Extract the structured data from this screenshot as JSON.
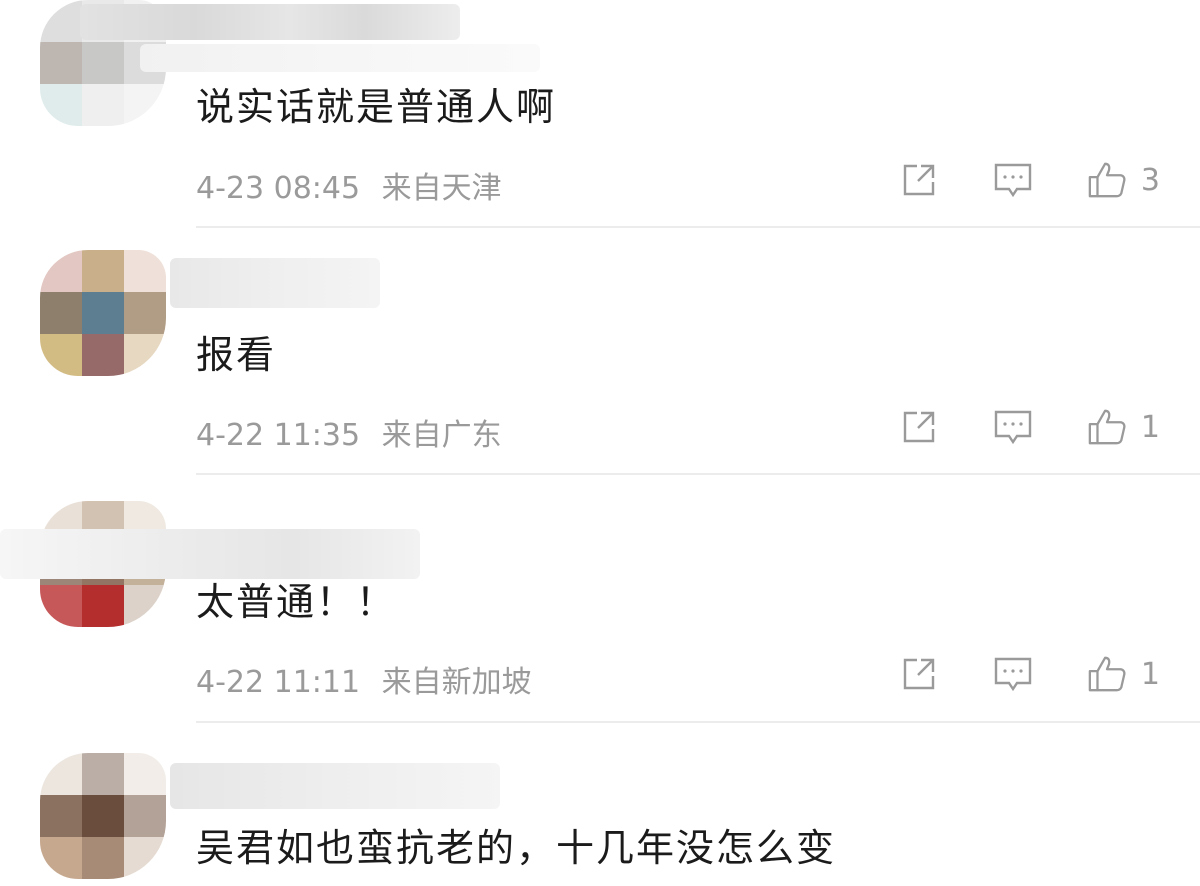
{
  "comments": [
    {
      "text": "说实话就是普通人啊",
      "time": "4-23 08:45",
      "location": "来自天津",
      "likes": "3"
    },
    {
      "text": "报看",
      "time": "4-22 11:35",
      "location": "来自广东",
      "likes": "1"
    },
    {
      "text": "太普通！！",
      "time": "4-22 11:11",
      "location": "来自新加坡",
      "likes": "1"
    },
    {
      "text": "吴君如也蛮抗老的，十几年没怎么变"
    }
  ],
  "icons": {
    "share": "share-icon",
    "comment": "comment-icon",
    "like": "thumbs-up-icon"
  },
  "colors": {
    "text": "#1b1b1b",
    "meta": "#9a9a9a",
    "divider": "#ececec"
  }
}
